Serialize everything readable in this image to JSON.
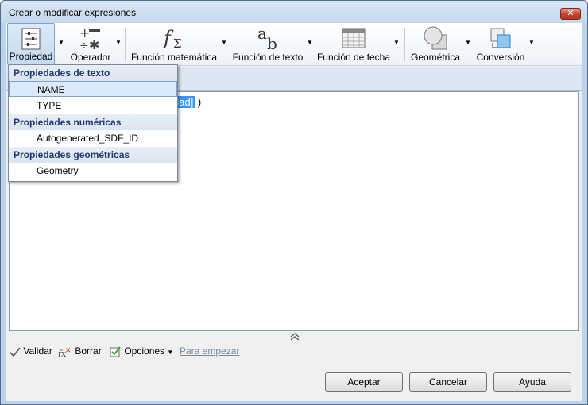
{
  "window": {
    "title": "Crear o modificar expresiones",
    "close_label": "✕"
  },
  "toolbar": {
    "propiedad": "Propiedad",
    "operador": "Operador",
    "funcion_matematica": "Función matemática",
    "funcion_texto": "Función de texto",
    "funcion_fecha": "Función de fecha",
    "geometrica": "Geométrica",
    "conversion": "Conversión"
  },
  "dropdown": {
    "groups": [
      {
        "label": "Propiedades de texto",
        "items": [
          "NAME",
          "TYPE"
        ]
      },
      {
        "label": "Propiedades numéricas",
        "items": [
          "Autogenerated_SDF_ID"
        ]
      },
      {
        "label": "Propiedades geométricas",
        "items": [
          "Geometry"
        ]
      }
    ],
    "selected_item": "NAME"
  },
  "editor": {
    "expression_selected": "dad]",
    "expression_tail": " )"
  },
  "bottom_tools": {
    "validar": "Validar",
    "borrar": "Borrar",
    "opciones": "Opciones",
    "para_empezar": "Para empezar"
  },
  "buttons": {
    "aceptar": "Aceptar",
    "cancelar": "Cancelar",
    "ayuda": "Ayuda"
  }
}
